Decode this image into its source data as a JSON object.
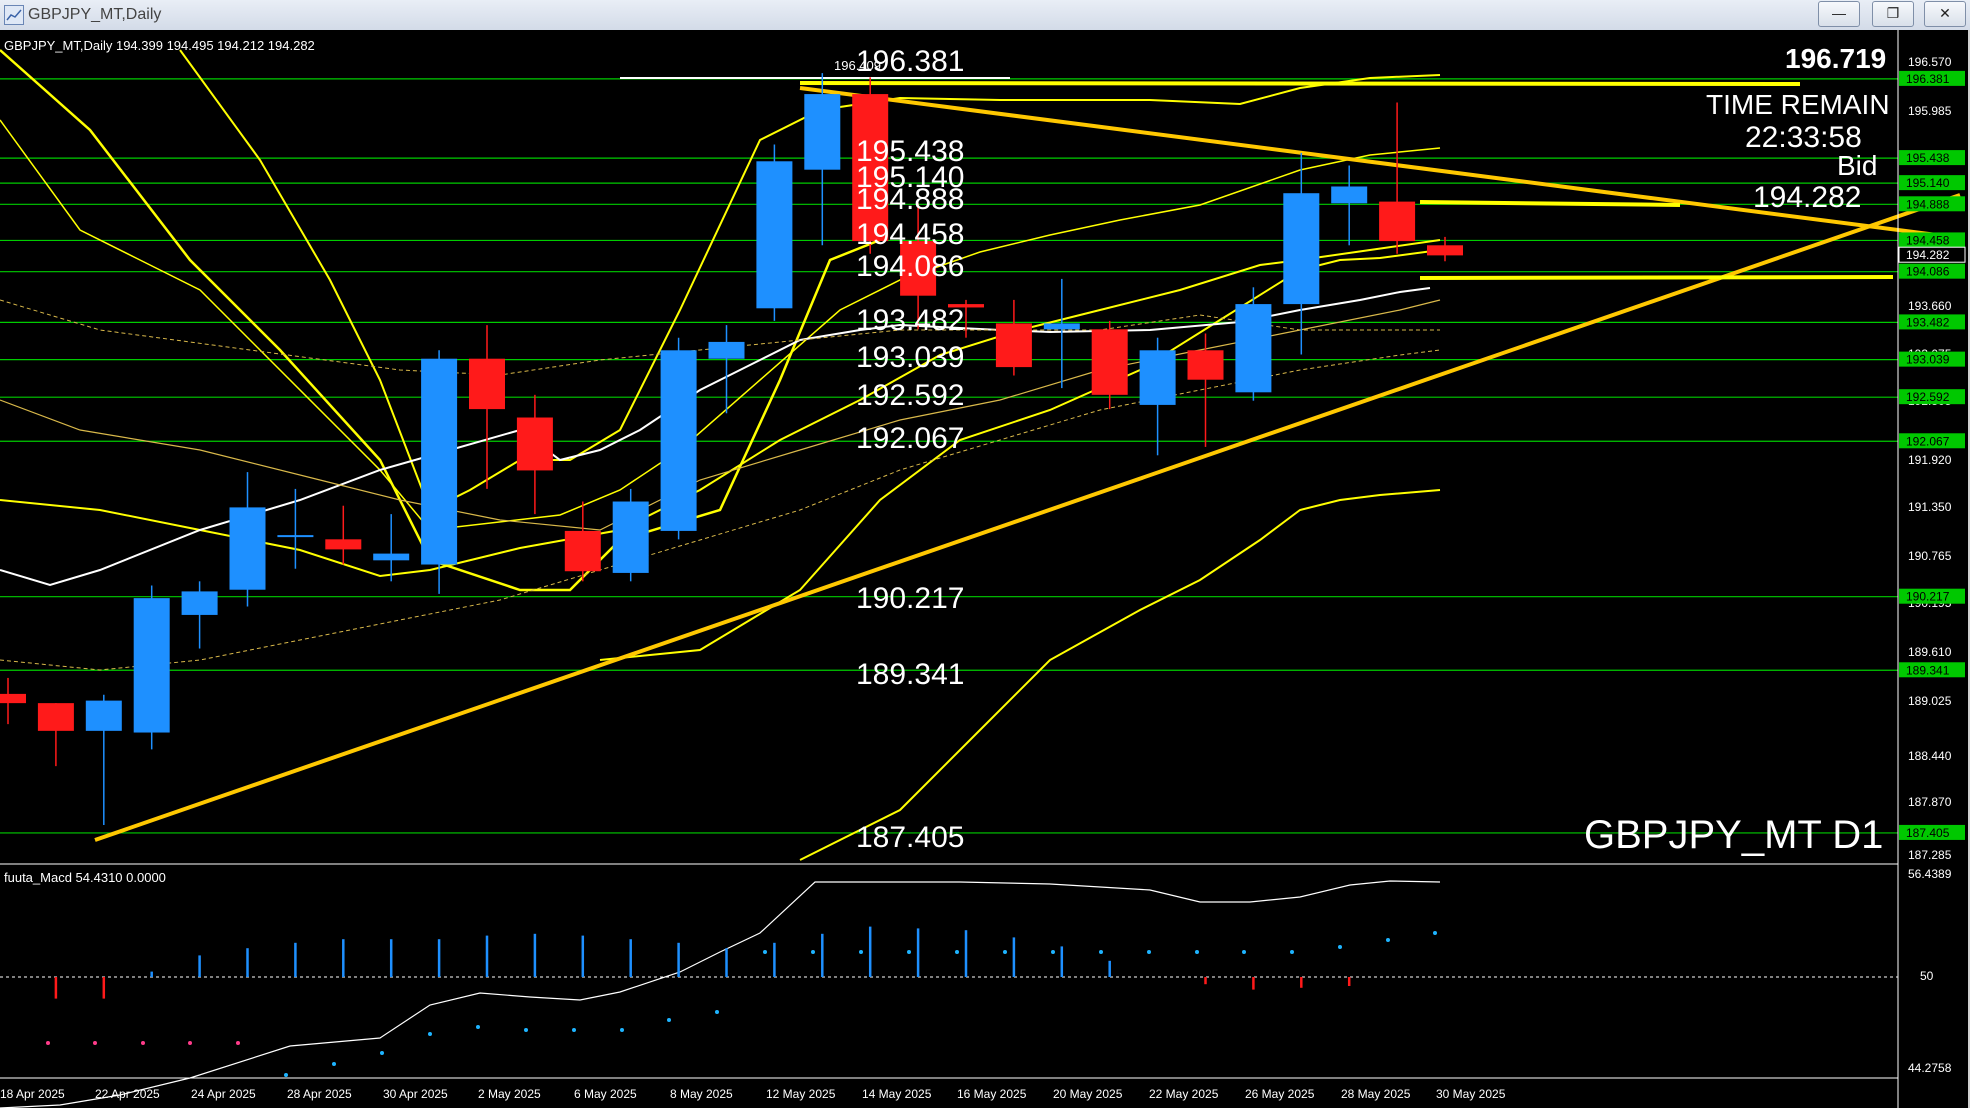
{
  "window": {
    "title": "GBPJPY_MT,Daily",
    "minimize_icon": "minimize-icon",
    "maximize_icon": "restore-icon",
    "close_icon": "close-icon"
  },
  "chart_header": {
    "text": "GBPJPY_MT,Daily  194.399 194.495 194.212 194.282"
  },
  "symbol_label": "GBPJPY_MT  D1",
  "big_price": "196.719",
  "time_remain_label": "TIME REMAIN",
  "time_remain_value": "22:33:58",
  "bid_label": "Bid",
  "bid_value": "194.282",
  "level_labels": [
    "196.381",
    "195.438",
    "195.140",
    "194.888",
    "194.458",
    "194.086",
    "193.482",
    "193.039",
    "192.592",
    "192.067",
    "190.217",
    "189.341",
    "187.405"
  ],
  "level_label_top_small": "196.409",
  "price_axis": {
    "ticks": [
      "196.570",
      "195.985",
      "195.400",
      "194.815",
      "194.230",
      "193.660",
      "193.075",
      "192.505",
      "191.920",
      "191.350",
      "190.765",
      "190.195",
      "189.610",
      "189.025",
      "188.440",
      "187.870",
      "187.285"
    ],
    "boxes": [
      "196.381",
      "195.438",
      "195.140",
      "194.888",
      "194.458",
      "194.282",
      "194.086",
      "193.482",
      "193.039",
      "192.592",
      "192.067",
      "190.217",
      "189.341",
      "187.405"
    ]
  },
  "macd": {
    "label": "fuuta_Macd 54.4310  0.0000",
    "axis_top": "56.4389",
    "axis_mid": "50",
    "axis_bottom": "44.2758"
  },
  "date_axis": [
    "18 Apr 2025",
    "22 Apr 2025",
    "24 Apr 2025",
    "28 Apr 2025",
    "30 Apr 2025",
    "2 May 2025",
    "6 May 2025",
    "8 May 2025",
    "12 May 2025",
    "14 May 2025",
    "16 May 2025",
    "20 May 2025",
    "22 May 2025",
    "26 May 2025",
    "28 May 2025",
    "30 May 2025"
  ],
  "colors": {
    "background": "#000000",
    "bull_candle": "#1e90ff",
    "bear_candle": "#ff1a1a",
    "level_line": "#00cc00",
    "bands": "#ffff00",
    "trendline": "#ffc800",
    "ma_white": "#ffffff",
    "axis_box_level": "#00c800"
  },
  "chart_data": {
    "type": "candlestick",
    "title": "GBPJPY_MT,Daily",
    "x": [
      "17 Apr",
      "18 Apr",
      "21 Apr",
      "22 Apr",
      "23 Apr",
      "24 Apr",
      "25 Apr",
      "28 Apr",
      "29 Apr",
      "30 Apr",
      "1 May",
      "2 May",
      "5 May",
      "6 May",
      "7 May",
      "8 May",
      "9 May",
      "12 May",
      "13 May",
      "14 May",
      "15 May",
      "16 May",
      "19 May",
      "20 May",
      "21 May",
      "22 May",
      "23 May",
      "26 May",
      "27 May",
      "28 May",
      "29 May",
      "30 May"
    ],
    "series": [
      {
        "open": 189.06,
        "high": 189.25,
        "low": 188.7,
        "close": 188.95
      },
      {
        "open": 188.95,
        "high": 188.95,
        "low": 188.2,
        "close": 188.62
      },
      {
        "open": 188.62,
        "high": 189.05,
        "low": 187.5,
        "close": 188.98
      },
      {
        "open": 188.6,
        "high": 190.35,
        "low": 188.4,
        "close": 190.2
      },
      {
        "open": 190.0,
        "high": 190.4,
        "low": 189.6,
        "close": 190.28
      },
      {
        "open": 190.3,
        "high": 191.7,
        "low": 190.1,
        "close": 191.28
      },
      {
        "open": 190.95,
        "high": 191.5,
        "low": 190.55,
        "close": 190.95
      },
      {
        "open": 190.9,
        "high": 191.3,
        "low": 190.6,
        "close": 190.78
      },
      {
        "open": 190.65,
        "high": 191.2,
        "low": 190.4,
        "close": 190.73
      },
      {
        "open": 190.6,
        "high": 193.15,
        "low": 190.25,
        "close": 193.05
      },
      {
        "open": 193.05,
        "high": 193.45,
        "low": 191.5,
        "close": 192.45
      },
      {
        "open": 192.35,
        "high": 192.62,
        "low": 191.2,
        "close": 191.72
      },
      {
        "open": 191.0,
        "high": 191.35,
        "low": 190.4,
        "close": 190.52
      },
      {
        "open": 190.5,
        "high": 191.5,
        "low": 190.4,
        "close": 191.35
      },
      {
        "open": 191.0,
        "high": 193.3,
        "low": 190.9,
        "close": 193.15
      },
      {
        "open": 193.05,
        "high": 193.45,
        "low": 192.4,
        "close": 193.25
      },
      {
        "open": 193.65,
        "high": 195.6,
        "low": 193.5,
        "close": 195.4
      },
      {
        "open": 195.3,
        "high": 196.45,
        "low": 194.4,
        "close": 196.2
      },
      {
        "open": 196.2,
        "high": 196.4,
        "low": 194.3,
        "close": 194.45
      },
      {
        "open": 194.45,
        "high": 194.9,
        "low": 193.4,
        "close": 193.8
      },
      {
        "open": 193.7,
        "high": 193.75,
        "low": 193.3,
        "close": 193.66
      },
      {
        "open": 193.47,
        "high": 193.75,
        "low": 192.85,
        "close": 192.95
      },
      {
        "open": 193.4,
        "high": 194.0,
        "low": 192.7,
        "close": 193.47
      },
      {
        "open": 193.4,
        "high": 193.5,
        "low": 192.45,
        "close": 192.62
      },
      {
        "open": 192.5,
        "high": 193.3,
        "low": 191.9,
        "close": 193.15
      },
      {
        "open": 193.15,
        "high": 193.35,
        "low": 192.0,
        "close": 192.8
      },
      {
        "open": 192.65,
        "high": 193.9,
        "low": 192.55,
        "close": 193.7
      },
      {
        "open": 193.7,
        "high": 195.5,
        "low": 193.1,
        "close": 195.02
      },
      {
        "open": 194.9,
        "high": 195.35,
        "low": 194.4,
        "close": 195.1
      },
      {
        "open": 194.92,
        "high": 196.1,
        "low": 194.3,
        "close": 194.45
      },
      {
        "open": 194.4,
        "high": 194.5,
        "low": 194.21,
        "close": 194.28
      }
    ],
    "ylim": [
      187.1,
      196.8
    ],
    "levels": [
      196.381,
      195.438,
      195.14,
      194.888,
      194.458,
      194.086,
      193.482,
      193.039,
      192.592,
      192.067,
      190.217,
      189.341,
      187.405
    ]
  }
}
